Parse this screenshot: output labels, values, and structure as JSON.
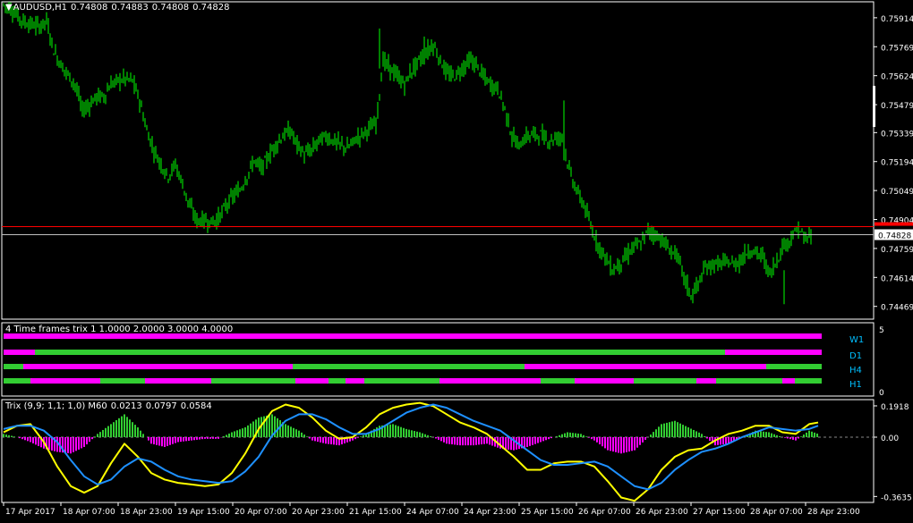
{
  "window_title": {
    "symbol": "AUDUSD,H1",
    "ohlc": [
      "0.74808",
      "0.74883",
      "0.74808",
      "0.74828"
    ]
  },
  "colors": {
    "background": "#000000",
    "candle_bull": "#00ff00",
    "candle_bear": "#00ff00",
    "price_line_red": "#ff0000",
    "price_line_gray": "#c0c0c0",
    "tf_up": "#32cd32",
    "tf_down": "#ff00ff",
    "tf_label": "#00bfff",
    "trix_main": "#ffff00",
    "trix_signal": "#1e90ff",
    "hist_up": "#32cd32",
    "hist_down": "#ff00ff",
    "scroll_marker": "#ffffff"
  },
  "price_panel": {
    "y_ticks": [
      "0.75914",
      "0.75769",
      "0.75624",
      "0.75479",
      "0.75339",
      "0.75194",
      "0.75049",
      "0.74904",
      "0.74759",
      "0.74614",
      "0.74469"
    ],
    "current_price": "0.74828",
    "red_line_price": "0.74868",
    "chart_data": {
      "type": "line",
      "title": "",
      "series": [
        {
          "x": [
            0,
            8,
            16,
            24,
            32,
            40,
            48,
            56,
            64,
            72,
            80,
            88,
            96,
            104,
            112,
            120,
            128,
            136,
            144,
            152,
            160,
            168,
            176,
            184,
            192,
            200,
            208,
            216,
            224,
            232,
            240,
            248,
            256,
            264,
            272,
            280,
            288,
            296,
            304,
            312,
            320,
            328,
            336,
            344,
            352,
            360,
            368,
            376,
            384,
            392,
            400,
            408,
            416,
            424,
            432,
            440,
            448,
            456,
            464,
            472,
            480,
            488,
            496,
            504,
            512,
            520,
            528,
            536,
            544,
            552,
            560,
            568,
            576,
            584,
            592,
            600,
            608,
            616,
            624,
            632,
            640,
            648,
            656,
            664,
            672,
            680,
            688,
            696,
            704,
            712,
            720,
            728,
            736,
            744,
            752,
            760,
            768,
            776,
            784,
            792,
            800,
            808,
            816,
            824,
            832,
            840,
            848,
            856,
            864,
            872,
            880,
            888,
            896,
            904
          ],
          "values": [
            0.7598,
            0.7596,
            0.7592,
            0.7589,
            0.7588,
            0.7587,
            0.759,
            0.7575,
            0.7568,
            0.7563,
            0.7558,
            0.7545,
            0.7548,
            0.7552,
            0.7552,
            0.7558,
            0.756,
            0.7561,
            0.756,
            0.755,
            0.7535,
            0.7525,
            0.7518,
            0.7512,
            0.7518,
            0.7508,
            0.7497,
            0.749,
            0.749,
            0.7489,
            0.7491,
            0.7497,
            0.7502,
            0.7505,
            0.7512,
            0.752,
            0.7516,
            0.7522,
            0.7528,
            0.7532,
            0.7535,
            0.7528,
            0.7523,
            0.7525,
            0.753,
            0.7532,
            0.753,
            0.7528,
            0.7526,
            0.753,
            0.7533,
            0.7536,
            0.7538,
            0.757,
            0.7566,
            0.7562,
            0.7558,
            0.7565,
            0.757,
            0.7574,
            0.7578,
            0.757,
            0.7563,
            0.7562,
            0.7566,
            0.757,
            0.7568,
            0.7562,
            0.7558,
            0.7556,
            0.7546,
            0.7532,
            0.7527,
            0.7532,
            0.7533,
            0.7533,
            0.753,
            0.7531,
            0.7532,
            0.7515,
            0.7505,
            0.7498,
            0.7487,
            0.7478,
            0.7472,
            0.7465,
            0.7468,
            0.7472,
            0.7477,
            0.7478,
            0.7485,
            0.7483,
            0.748,
            0.7475,
            0.7473,
            0.7462,
            0.7452,
            0.7458,
            0.7466,
            0.7468,
            0.7468,
            0.7469,
            0.7468,
            0.747,
            0.7475,
            0.7474,
            0.7472,
            0.7463,
            0.747,
            0.7478,
            0.7481,
            0.7486,
            0.748,
            0.7483
          ]
        }
      ],
      "ylim": [
        0.74405,
        0.75994
      ],
      "grid": false
    }
  },
  "tf_panel": {
    "title": "4 Time frames trix 1 1.0000 2.0000 3.0000 4.0000",
    "y_ticks": [
      "5",
      "0"
    ],
    "rows": [
      {
        "label": "W1",
        "segments": [
          {
            "from": 0,
            "to": 914,
            "state": "down"
          }
        ]
      },
      {
        "label": "D1",
        "segments": [
          {
            "from": 0,
            "to": 35,
            "state": "down"
          },
          {
            "from": 35,
            "to": 806,
            "state": "up"
          },
          {
            "from": 806,
            "to": 914,
            "state": "down"
          }
        ]
      },
      {
        "label": "H4",
        "segments": [
          {
            "from": 0,
            "to": 22,
            "state": "up"
          },
          {
            "from": 22,
            "to": 323,
            "state": "down"
          },
          {
            "from": 323,
            "to": 582,
            "state": "up"
          },
          {
            "from": 582,
            "to": 852,
            "state": "down"
          },
          {
            "from": 852,
            "to": 914,
            "state": "up"
          }
        ]
      },
      {
        "label": "H1",
        "segments": [
          {
            "from": 0,
            "to": 30,
            "state": "up"
          },
          {
            "from": 30,
            "to": 108,
            "state": "down"
          },
          {
            "from": 108,
            "to": 158,
            "state": "up"
          },
          {
            "from": 158,
            "to": 232,
            "state": "down"
          },
          {
            "from": 232,
            "to": 326,
            "state": "up"
          },
          {
            "from": 326,
            "to": 363,
            "state": "down"
          },
          {
            "from": 363,
            "to": 382,
            "state": "up"
          },
          {
            "from": 382,
            "to": 403,
            "state": "down"
          },
          {
            "from": 403,
            "to": 487,
            "state": "up"
          },
          {
            "from": 487,
            "to": 600,
            "state": "down"
          },
          {
            "from": 600,
            "to": 638,
            "state": "up"
          },
          {
            "from": 638,
            "to": 704,
            "state": "down"
          },
          {
            "from": 704,
            "to": 774,
            "state": "up"
          },
          {
            "from": 774,
            "to": 796,
            "state": "down"
          },
          {
            "from": 796,
            "to": 870,
            "state": "up"
          },
          {
            "from": 870,
            "to": 884,
            "state": "down"
          },
          {
            "from": 884,
            "to": 914,
            "state": "up"
          }
        ]
      }
    ]
  },
  "trix_panel": {
    "title": "Trix (9,9; 1,1; 1,0) M60",
    "values": [
      "0.0213",
      "0.0797",
      "0.0584"
    ],
    "y_ticks": [
      "0.1918",
      "0.00",
      "-0.3635"
    ],
    "chart_data": {
      "type": "line",
      "title": "",
      "x": [
        0,
        15,
        30,
        45,
        60,
        75,
        90,
        105,
        120,
        135,
        150,
        165,
        180,
        195,
        210,
        225,
        240,
        255,
        270,
        285,
        300,
        315,
        330,
        345,
        360,
        375,
        390,
        405,
        420,
        435,
        450,
        465,
        480,
        495,
        510,
        525,
        540,
        555,
        570,
        585,
        600,
        615,
        630,
        645,
        660,
        675,
        690,
        705,
        720,
        735,
        750,
        765,
        780,
        795,
        810,
        825,
        840,
        855,
        870,
        885,
        900,
        910
      ],
      "series": [
        {
          "values": [
            0.03,
            0.07,
            0.08,
            -0.03,
            -0.18,
            -0.3,
            -0.34,
            -0.3,
            -0.16,
            -0.04,
            -0.12,
            -0.22,
            -0.26,
            -0.28,
            -0.29,
            -0.3,
            -0.29,
            -0.22,
            -0.1,
            0.05,
            0.16,
            0.2,
            0.18,
            0.12,
            0.04,
            -0.01,
            0.0,
            0.06,
            0.14,
            0.18,
            0.2,
            0.21,
            0.19,
            0.14,
            0.09,
            0.06,
            0.02,
            -0.05,
            -0.12,
            -0.2,
            -0.2,
            -0.16,
            -0.15,
            -0.15,
            -0.18,
            -0.27,
            -0.37,
            -0.39,
            -0.32,
            -0.2,
            -0.12,
            -0.08,
            -0.07,
            -0.02,
            0.02,
            0.04,
            0.07,
            0.07,
            0.03,
            0.02,
            0.08,
            0.09
          ]
        },
        {
          "values": [
            0.05,
            0.07,
            0.07,
            0.04,
            -0.03,
            -0.14,
            -0.24,
            -0.29,
            -0.26,
            -0.18,
            -0.13,
            -0.15,
            -0.2,
            -0.24,
            -0.26,
            -0.27,
            -0.28,
            -0.27,
            -0.21,
            -0.12,
            0.01,
            0.1,
            0.14,
            0.14,
            0.11,
            0.06,
            0.02,
            0.02,
            0.05,
            0.1,
            0.15,
            0.18,
            0.2,
            0.18,
            0.14,
            0.1,
            0.07,
            0.04,
            -0.02,
            -0.08,
            -0.14,
            -0.17,
            -0.17,
            -0.16,
            -0.15,
            -0.18,
            -0.24,
            -0.3,
            -0.32,
            -0.28,
            -0.2,
            -0.14,
            -0.09,
            -0.07,
            -0.04,
            0.0,
            0.03,
            0.06,
            0.05,
            0.04,
            0.05,
            0.07
          ]
        }
      ],
      "histogram": [
        0.02,
        0.0,
        -0.03,
        -0.07,
        -0.09,
        -0.1,
        -0.06,
        0.02,
        0.08,
        0.14,
        0.06,
        -0.04,
        -0.06,
        -0.03,
        -0.02,
        -0.01,
        -0.01,
        0.03,
        0.06,
        0.12,
        0.14,
        0.08,
        0.04,
        -0.02,
        -0.04,
        -0.05,
        -0.02,
        0.02,
        0.07,
        0.08,
        0.05,
        0.03,
        0.0,
        -0.04,
        -0.05,
        -0.05,
        -0.04,
        -0.07,
        -0.08,
        -0.06,
        -0.03,
        0.0,
        0.03,
        0.02,
        -0.02,
        -0.08,
        -0.1,
        -0.08,
        0.0,
        0.08,
        0.1,
        0.06,
        0.02,
        -0.05,
        -0.04,
        0.0,
        0.04,
        0.03,
        0.0,
        -0.02,
        0.04,
        0.02
      ],
      "ylim": [
        -0.4,
        0.23
      ],
      "grid": false
    }
  },
  "time_axis": {
    "labels": [
      "17 Apr 2017",
      "18 Apr 07:00",
      "18 Apr 23:00",
      "19 Apr 15:00",
      "20 Apr 07:00",
      "20 Apr 23:00",
      "21 Apr 15:00",
      "24 Apr 07:00",
      "24 Apr 23:00",
      "25 Apr 15:00",
      "26 Apr 07:00",
      "26 Apr 23:00",
      "27 Apr 15:00",
      "28 Apr 07:00",
      "28 Apr 23:00"
    ]
  }
}
